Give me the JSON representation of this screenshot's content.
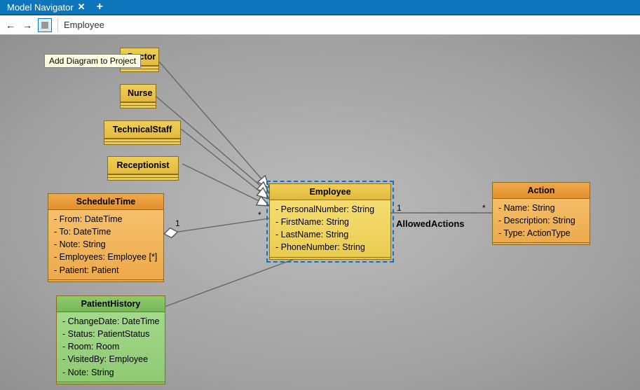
{
  "titlebar": {
    "tab_label": "Model Navigator",
    "close": "✕",
    "plus": "+"
  },
  "toolbar": {
    "back": "←",
    "forward": "→",
    "breadcrumb": "Employee"
  },
  "tooltip": "Add Diagram to Project",
  "classes": {
    "doctor": {
      "name": "Doctor"
    },
    "nurse": {
      "name": "Nurse"
    },
    "technical": {
      "name": "TechnicalStaff"
    },
    "receptionist": {
      "name": "Receptionist"
    },
    "schedule": {
      "name": "ScheduleTime",
      "attrs": [
        "- From: DateTime",
        "- To: DateTime",
        "- Note: String",
        "- Employees: Employee [*]",
        "- Patient: Patient"
      ]
    },
    "employee": {
      "name": "Employee",
      "attrs": [
        "- PersonalNumber: String",
        "- FirstName: String",
        "- LastName: String",
        "- PhoneNumber: String"
      ]
    },
    "action": {
      "name": "Action",
      "attrs": [
        "- Name: String",
        "- Description: String",
        "- Type: ActionType"
      ]
    },
    "history": {
      "name": "PatientHistory",
      "attrs": [
        "- ChangeDate: DateTime",
        "- Status: PatientStatus",
        "- Room: Room",
        "- VisitedBy: Employee",
        "- Note: String"
      ]
    }
  },
  "assoc": {
    "allowed": "AllowedActions",
    "m_sched_1": "1",
    "m_sched_star": "*",
    "m_emp_1": "1",
    "m_action_star": "*"
  }
}
